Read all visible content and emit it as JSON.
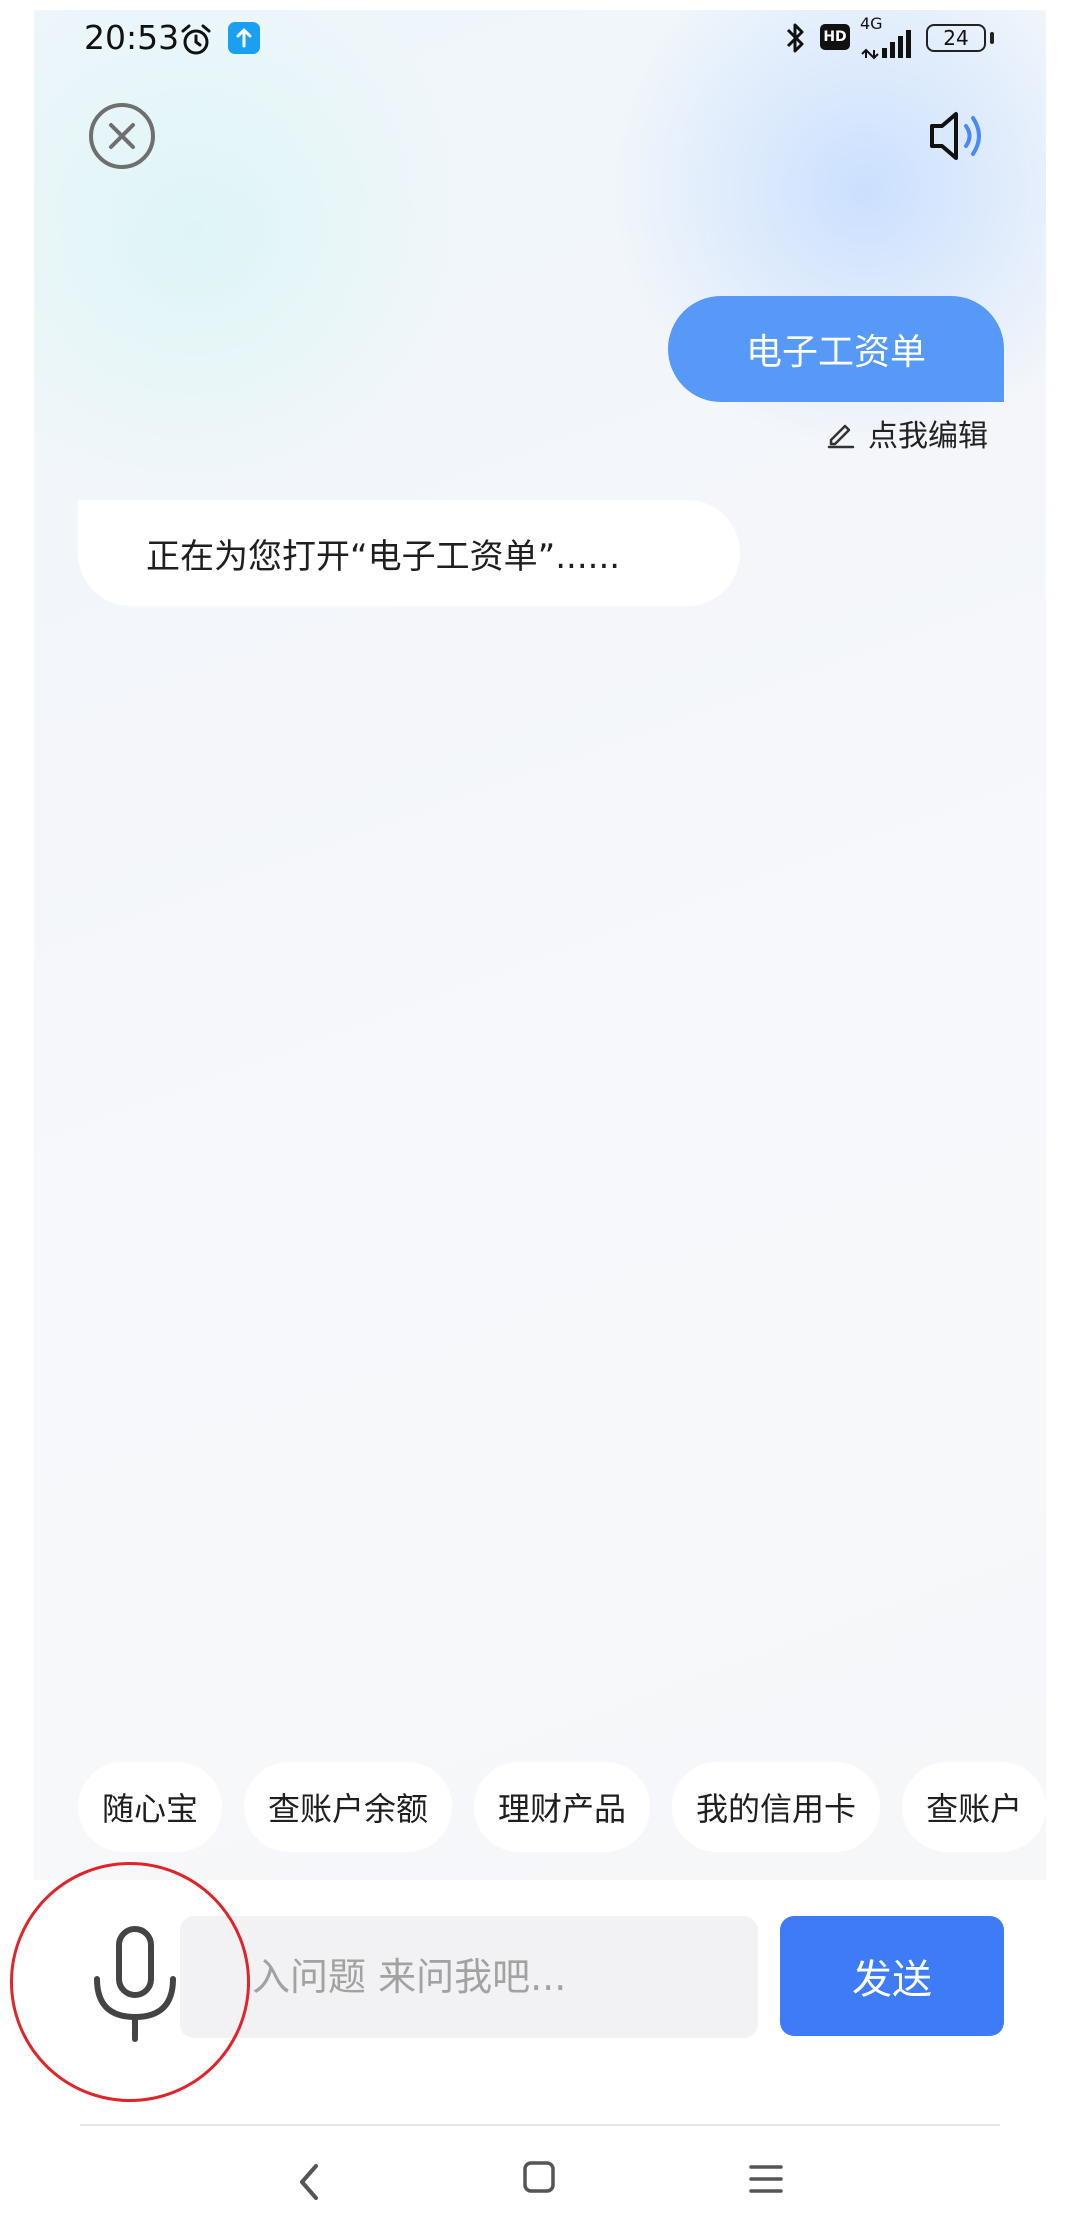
{
  "status_bar": {
    "time": "20:53",
    "network_label": "4G",
    "battery_level": "24",
    "hd_label": "HD",
    "icons": [
      "alarm-icon",
      "upload-icon",
      "bluetooth-icon",
      "hd-icon",
      "signal-icon",
      "battery-icon"
    ]
  },
  "header": {
    "close_icon": "close-circle-icon",
    "speaker_icon": "speaker-icon"
  },
  "conversation": {
    "user_message": "电子工资单",
    "edit_hint": "点我编辑",
    "bot_message": "正在为您打开“电子工资单”......"
  },
  "suggestions": [
    {
      "label": "随心宝"
    },
    {
      "label": "查账户余额"
    },
    {
      "label": "理财产品"
    },
    {
      "label": "我的信用卡"
    },
    {
      "label": "查账户"
    }
  ],
  "input": {
    "placeholder": "入问题 来问我吧...",
    "send_label": "发送",
    "mic_icon": "microphone-icon"
  },
  "navigation": {
    "icons": [
      "back-icon",
      "home-icon",
      "menu-icon"
    ]
  },
  "colors": {
    "accent": "#3e7bf6",
    "user_bubble": "#5799f7",
    "highlight_circle": "#e0242b"
  }
}
